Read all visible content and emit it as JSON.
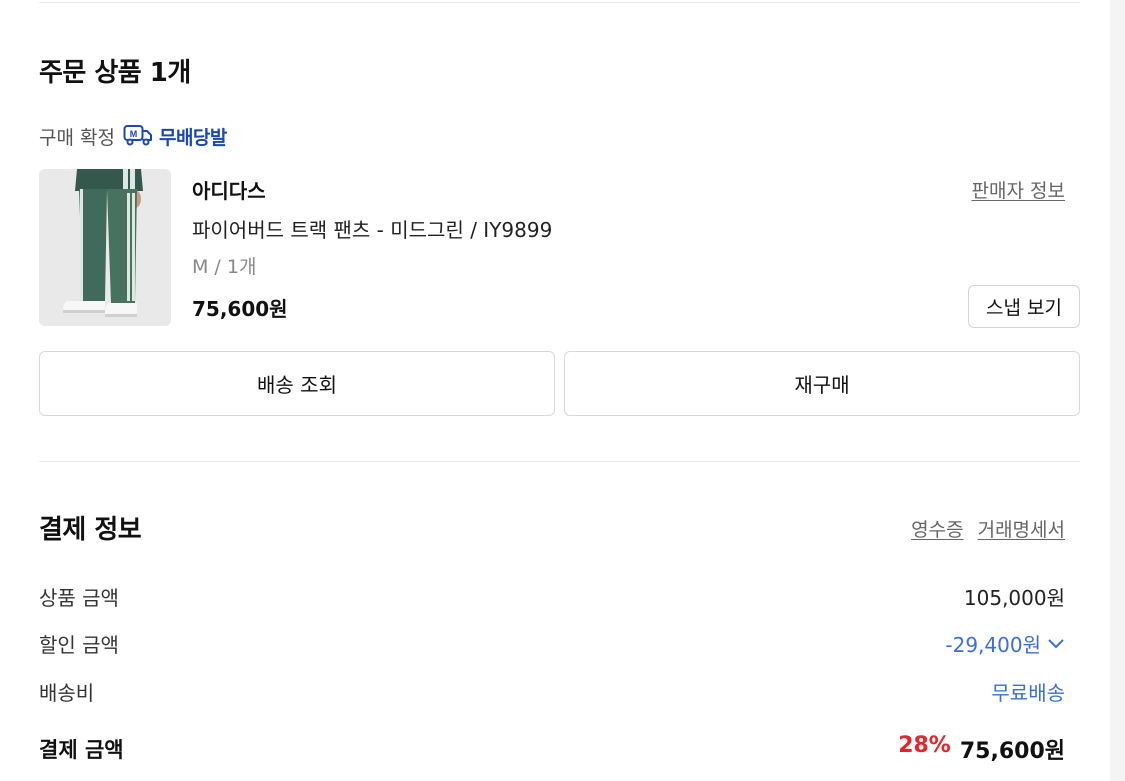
{
  "order": {
    "section_title": "주문 상품 1개",
    "status": "구매 확정",
    "delivery_badge": {
      "icon": "free-shipping-truck-icon",
      "label": "무배당발"
    },
    "product": {
      "brand": "아디다스",
      "name": "파이어버드 트랙 팬츠 - 미드그린 / IY9899",
      "option": "M / 1개",
      "price": "75,600원",
      "seller_info_link": "판매자 정보",
      "snap_button": "스냅 보기"
    },
    "actions": {
      "track_delivery": "배송 조회",
      "reorder": "재구매"
    }
  },
  "payment": {
    "section_title": "결제 정보",
    "receipt_link": "영수증",
    "statement_link": "거래명세서",
    "rows": {
      "product_amount": {
        "label": "상품 금액",
        "value": "105,000원"
      },
      "discount_amount": {
        "label": "할인 금액",
        "value": "-29,400원"
      },
      "shipping": {
        "label": "배송비",
        "value": "무료배송"
      }
    },
    "total": {
      "label": "결제 금액",
      "discount_rate": "28%",
      "value": "75,600원"
    }
  },
  "colors": {
    "accent_blue": "#3a6fd4",
    "badge_blue": "#1b47b4",
    "discount_red": "#e6242b"
  }
}
